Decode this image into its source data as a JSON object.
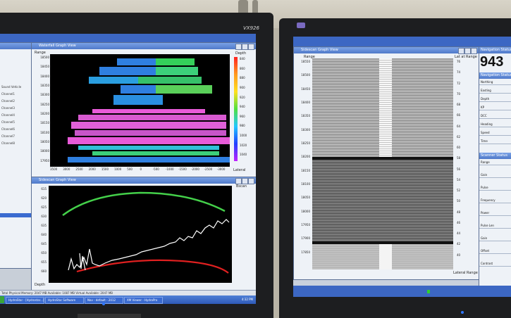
{
  "left_monitor": {
    "brand": "VX926",
    "waterfall_window": {
      "title": "Waterfall Graph View",
      "y_axis_label": "Range",
      "y_ticks": [
        "18500",
        "18450",
        "18400",
        "18350",
        "18300",
        "18250",
        "18200",
        "18150",
        "18100",
        "18050",
        "18000",
        "17950"
      ],
      "x_ticks": [
        "3500",
        "3000",
        "2500",
        "2000",
        "1500",
        "1000",
        "500",
        "0",
        "-500",
        "-1000",
        "-1500",
        "-2000",
        "-2500",
        "-3000"
      ],
      "legend_title": "Depth",
      "legend_ticks": [
        "840",
        "860",
        "880",
        "900",
        "920",
        "940",
        "960",
        "980",
        "1000",
        "1020",
        "1040"
      ],
      "legend_foot": "Lateral"
    },
    "sidescan_window": {
      "title": "Sidescan Graph View",
      "y_ticks": [
        "615",
        "620",
        "625",
        "630",
        "635",
        "640",
        "645",
        "650",
        "655",
        "660"
      ],
      "y_axis_label": "Depth",
      "right_label": "Bscan"
    },
    "sidebar_rows": [
      "Sound Vehicle",
      "Channel1",
      "Channel2",
      "Channel3",
      "Channel4",
      "Channel5",
      "Channel6",
      "Channel7",
      "Channel8"
    ],
    "status_text": "Total Physical Memory: 2047 MB   Available: 1087 MB   Virtual Available: 2047 MB",
    "taskbar_items": [
      "HydroStar - [Hydrostar...]",
      "HydroStar Software",
      "Nav - default - 2012",
      "XM Viewer - HydroPro"
    ],
    "clock": "4:32 PM"
  },
  "right_monitor": {
    "sonar_window": {
      "title": "Sidescan Graph View",
      "range_label": "Range",
      "left_ticks": [
        "18550",
        "18500",
        "18450",
        "18400",
        "18350",
        "18300",
        "18250",
        "18200",
        "18150",
        "18100",
        "18050",
        "18000",
        "17950",
        "17900",
        "17850"
      ],
      "right_title": "Lat at Range",
      "right_ticks": [
        "76",
        "74",
        "72",
        "70",
        "68",
        "66",
        "64",
        "62",
        "60",
        "58",
        "56",
        "54",
        "52",
        "50",
        "48",
        "46",
        "44",
        "42",
        "40"
      ],
      "right_foot": "Lateral Range"
    },
    "nav_panel": {
      "title": "Navigation Status",
      "big_number": "943",
      "sub_title": "Navigation Status",
      "rows": [
        "Northing",
        "Easting",
        "Depth",
        "KP",
        "DCC",
        "Heading",
        "Speed",
        "Time"
      ],
      "second_title": "Scanner Status",
      "second_rows": [
        "Range",
        "Gain",
        "Pulse",
        "Frequency",
        "Power",
        "Pulse Len",
        "Gain",
        "Offset",
        "Contrast"
      ]
    }
  },
  "colors": {
    "plot_bg": "#000000",
    "blue_band": "#2f7fe0",
    "green_band": "#34d05a",
    "magenta_band": "#e85bd8",
    "red_trace": "#e02020",
    "green_trace": "#44d04a",
    "white_trace": "#ffffff",
    "title_blue": "#4f79c9"
  }
}
